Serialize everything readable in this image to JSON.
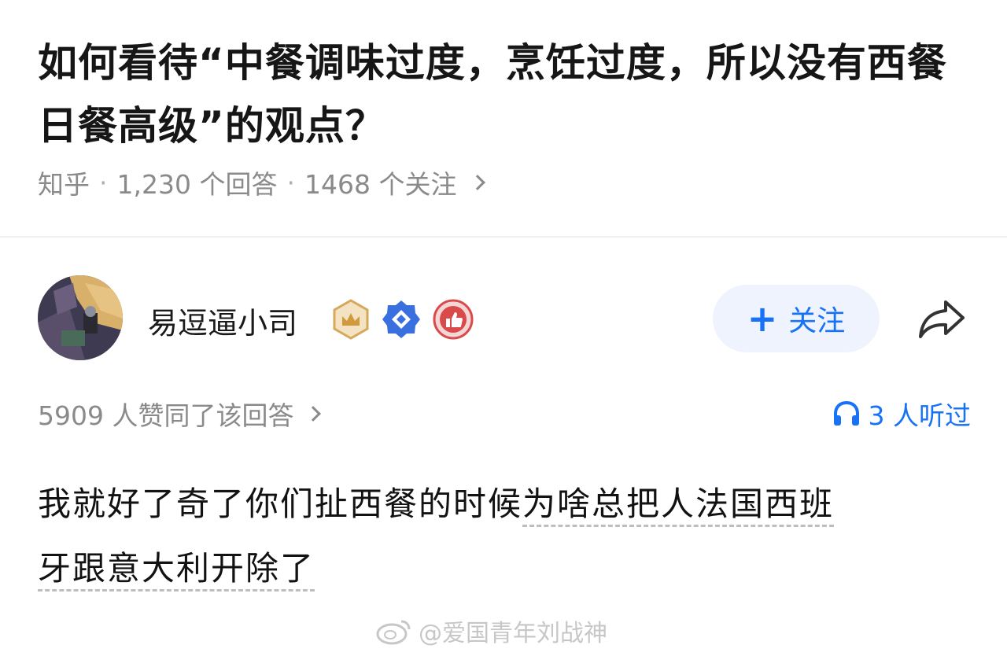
{
  "question": {
    "title": "如何看待“中餐调味过度，烹饪过度，所以没有西餐日餐高级”的观点？",
    "source": "知乎",
    "separator": "·",
    "answers": "1,230 个回答",
    "followers": "1468 个关注"
  },
  "author": {
    "name": "易逗逼小司",
    "follow_label": "关注",
    "follow_plus": "+"
  },
  "stats": {
    "votes": "5909 人赞同了该回答",
    "listened": "3 人听过"
  },
  "answer": {
    "text_plain": "我就好了奇了你们扯西餐的时候",
    "text_underlined_1": "为啥总把人法国西班",
    "text_underlined_2": "牙跟意大利开除了"
  },
  "watermark": {
    "text": "@爱国青年刘战神"
  },
  "colors": {
    "accent": "#1772f6",
    "follow_bg": "#eef3fd",
    "meta_gray": "#8a8a8a"
  }
}
